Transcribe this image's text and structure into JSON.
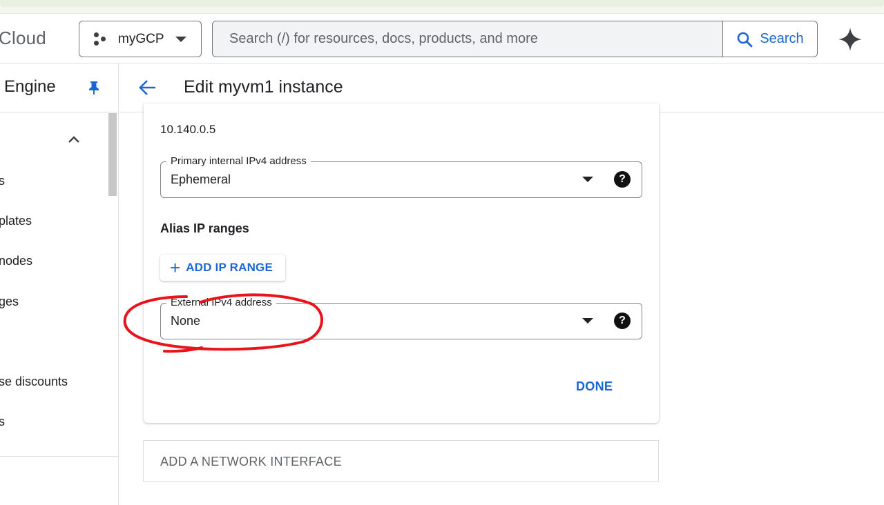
{
  "header": {
    "brand": "Cloud",
    "project": "myGCP",
    "search_placeholder": "Search (/) for resources, docs, products, and more",
    "search_button": "Search"
  },
  "sidebar": {
    "product_title": "Engine",
    "items": [
      {
        "label": "s"
      },
      {
        "label": "plates"
      },
      {
        "label": "nodes"
      },
      {
        "label": "ges"
      },
      {
        "label": "se discounts"
      },
      {
        "label": "s"
      }
    ]
  },
  "page": {
    "title": "Edit myvm1 instance"
  },
  "card": {
    "ip_value": "10.140.0.5",
    "primary_internal": {
      "label": "Primary internal IPv4 address",
      "value": "Ephemeral",
      "help": "?"
    },
    "alias_heading": "Alias IP ranges",
    "add_ip_range": "ADD IP RANGE",
    "external": {
      "label": "External IPv4 address",
      "value": "None",
      "help": "?"
    },
    "done": "DONE"
  },
  "add_network_interface": "ADD A NETWORK INTERFACE",
  "colors": {
    "accent": "#1a66d2",
    "annotation": "#e8131b"
  }
}
